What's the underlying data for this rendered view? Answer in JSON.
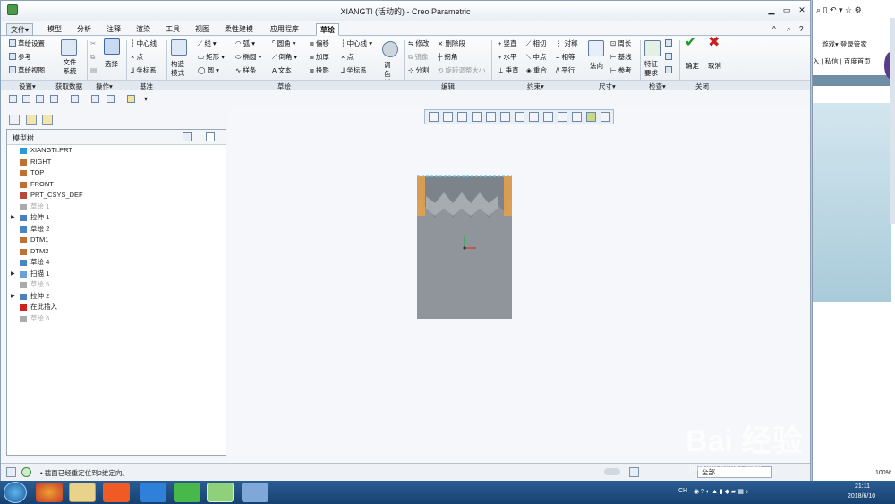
{
  "window": {
    "title": "XIANGTI (活动的) - Creo Parametric",
    "min": "▁",
    "max": "▭",
    "close": "✕"
  },
  "tabs": [
    {
      "label": "文件▾"
    },
    {
      "label": "模型"
    },
    {
      "label": "分析"
    },
    {
      "label": "注释"
    },
    {
      "label": "渲染"
    },
    {
      "label": "工具"
    },
    {
      "label": "视图"
    },
    {
      "label": "柔性建模"
    },
    {
      "label": "应用程序"
    },
    {
      "label": "草绘"
    }
  ],
  "tab_right": {
    "up": "^",
    "help": "?"
  },
  "ribbon": {
    "setup": [
      "草绘设置",
      "参考",
      "草绘视图"
    ],
    "file_system": "文件系统",
    "select": "选择",
    "datum": [
      "中心线",
      "点",
      "坐标系"
    ],
    "construction": "构造模式",
    "sketch_col1": [
      "线",
      "矩形",
      "圆"
    ],
    "sketch_col2": [
      "弧",
      "椭圆",
      "样条"
    ],
    "sketch_col3": [
      "圆角",
      "倒角",
      "文本"
    ],
    "sketch_col4": [
      "偏移",
      "加厚",
      "投影"
    ],
    "sketch_col5": [
      "中心线",
      "点",
      "坐标系"
    ],
    "palette": "调色板",
    "edit_col1": [
      "修改",
      "镜像",
      "分割"
    ],
    "edit_col2": [
      "删除段",
      "拐角",
      "旋转调整大小"
    ],
    "constraints_col1": [
      "竖直",
      "水平",
      "垂直"
    ],
    "constraints_col2": [
      "相切",
      "中点",
      "重合"
    ],
    "constraints_col3": [
      "对称",
      "相等",
      "平行"
    ],
    "normal": "法向",
    "dims": [
      "周长",
      "基线",
      "参考"
    ],
    "feature_req": "特征要求",
    "ok": "确定",
    "cancel": "取消"
  },
  "groups": [
    "设置▾",
    "获取数据",
    "操作▾",
    "基准",
    "草绘",
    "编辑",
    "约束▾",
    "尺寸▾",
    "检查▾",
    "关闭"
  ],
  "tree": {
    "title": "模型树",
    "items": [
      {
        "label": "XIANGTI.PRT",
        "disabled": false,
        "expand": ""
      },
      {
        "label": "RIGHT",
        "disabled": false,
        "expand": ""
      },
      {
        "label": "TOP",
        "disabled": false,
        "expand": ""
      },
      {
        "label": "FRONT",
        "disabled": false,
        "expand": ""
      },
      {
        "label": "PRT_CSYS_DEF",
        "disabled": false,
        "expand": ""
      },
      {
        "label": "草绘 1",
        "disabled": true,
        "expand": ""
      },
      {
        "label": "拉伸 1",
        "disabled": false,
        "expand": "▶"
      },
      {
        "label": "草绘 2",
        "disabled": false,
        "expand": ""
      },
      {
        "label": "DTM1",
        "disabled": false,
        "expand": ""
      },
      {
        "label": "DTM2",
        "disabled": false,
        "expand": ""
      },
      {
        "label": "草绘 4",
        "disabled": false,
        "expand": ""
      },
      {
        "label": "扫描 1",
        "disabled": false,
        "expand": "▶"
      },
      {
        "label": "草绘 5",
        "disabled": true,
        "expand": ""
      },
      {
        "label": "拉伸 2",
        "disabled": false,
        "expand": "▶"
      },
      {
        "label": "在此插入",
        "disabled": false,
        "expand": ""
      },
      {
        "label": "草绘 6",
        "disabled": true,
        "expand": ""
      }
    ]
  },
  "status": {
    "message": "• 截面已经重定位到2维定向。",
    "filter": "全部"
  },
  "browser": {
    "menu": [
      "游戏▾",
      "登录管家"
    ],
    "links": "入 | 私信 | 百度首页",
    "zoom": "100%"
  },
  "taskbar": {
    "lang": "CH",
    "time": "21:11",
    "date": "2018/6/10"
  },
  "watermark": {
    "brand": "Bai 经验",
    "url": "jingyan.baidu.com"
  },
  "colors": {
    "part": "#8f959b",
    "accent": "#f0a040",
    "ok": "#1f9a2a",
    "cancel": "#c62020"
  }
}
